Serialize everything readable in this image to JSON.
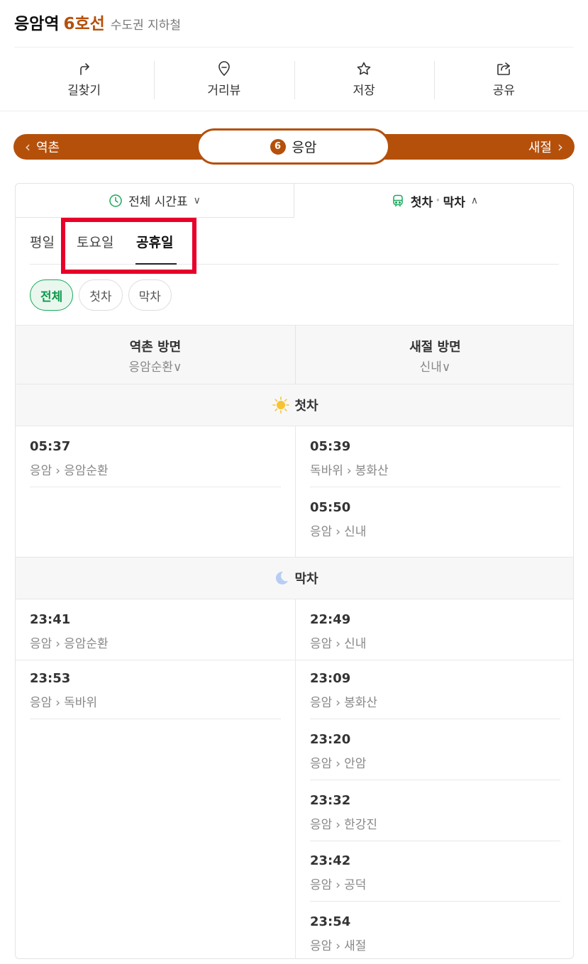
{
  "header": {
    "station": "응암역",
    "line": "6호선",
    "type": "수도권 지하철"
  },
  "actions": [
    {
      "label": "길찾기",
      "icon": "route-arrow-icon"
    },
    {
      "label": "거리뷰",
      "icon": "map-pin-icon"
    },
    {
      "label": "저장",
      "icon": "star-icon"
    },
    {
      "label": "공유",
      "icon": "share-icon"
    }
  ],
  "linebar": {
    "prev": "역촌",
    "current_line_number": "6",
    "current": "응암",
    "next": "새절",
    "color": "#b5500b"
  },
  "view_tabs": {
    "all": "전체 시간표",
    "first": "첫차",
    "last": "막차"
  },
  "day_tabs": [
    "평일",
    "토요일",
    "공휴일"
  ],
  "active_day": "공휴일",
  "filters": [
    "전체",
    "첫차",
    "막차"
  ],
  "active_filter": "전체",
  "directions": [
    {
      "name": "역촌 방면",
      "terminal": "응암순환"
    },
    {
      "name": "새절 방면",
      "terminal": "신내"
    }
  ],
  "first_train": {
    "label": "첫차",
    "left": [
      {
        "time": "05:37",
        "from": "응암",
        "to": "응암순환"
      }
    ],
    "right": [
      {
        "time": "05:39",
        "from": "독바위",
        "to": "봉화산"
      },
      {
        "time": "05:50",
        "from": "응암",
        "to": "신내"
      }
    ]
  },
  "last_train": {
    "label": "막차",
    "left": [
      {
        "time": "23:41",
        "from": "응암",
        "to": "응암순환"
      },
      {
        "time": "23:53",
        "from": "응암",
        "to": "독바위"
      }
    ],
    "right": [
      {
        "time": "22:49",
        "from": "응암",
        "to": "신내"
      },
      {
        "time": "23:09",
        "from": "응암",
        "to": "봉화산"
      },
      {
        "time": "23:20",
        "from": "응암",
        "to": "안암"
      },
      {
        "time": "23:32",
        "from": "응암",
        "to": "한강진"
      },
      {
        "time": "23:42",
        "from": "응암",
        "to": "공덕"
      },
      {
        "time": "23:54",
        "from": "응암",
        "to": "새절"
      }
    ]
  },
  "route_separator": "›",
  "colors": {
    "accent": "#b5500b",
    "active_green": "#0e9a4c",
    "highlight": "#e8002a"
  }
}
